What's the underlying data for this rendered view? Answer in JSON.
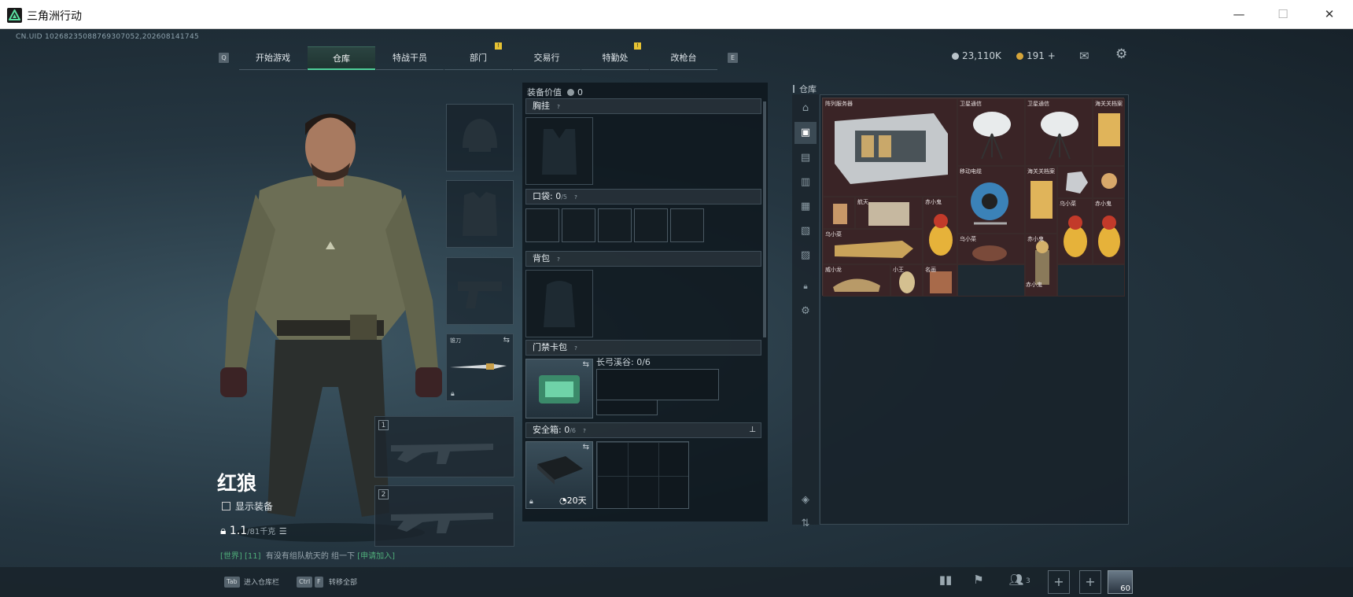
{
  "window": {
    "title": "三角洲行动",
    "minimize": "—",
    "maximize": "☐",
    "close": "✕"
  },
  "uid": "CN.UID 10268235088769307052,202608141745",
  "nav": {
    "left_key": "Q",
    "right_key": "E",
    "tabs": [
      {
        "label": "开始游戏",
        "active": false,
        "badge": ""
      },
      {
        "label": "仓库",
        "active": true,
        "badge": ""
      },
      {
        "label": "特战干员",
        "active": false,
        "badge": ""
      },
      {
        "label": "部门",
        "active": false,
        "badge": "!"
      },
      {
        "label": "交易行",
        "active": false,
        "badge": ""
      },
      {
        "label": "特勤处",
        "active": false,
        "badge": "!"
      },
      {
        "label": "改枪台",
        "active": false,
        "badge": ""
      }
    ]
  },
  "currency": {
    "hafcoin": "23,110K",
    "coupon": "191",
    "coupon_add": "+"
  },
  "character": {
    "name": "红狼",
    "show_equipment": "显示装备",
    "weight": "1.1",
    "weight_max": "/81千克",
    "chat_channel": "[世界] [11]",
    "chat_text": "有没有组队航天的 组一下",
    "chat_link": "[申请加入]"
  },
  "equipment": {
    "melee_label": "锥刀",
    "gun1_num": "1",
    "gun2_num": "2"
  },
  "loadout": {
    "value_label": "装备价值",
    "value": "0",
    "chest_label": "胸挂",
    "pocket_label": "口袋:",
    "pocket_used": "0",
    "pocket_max": "/5",
    "backpack_label": "背包",
    "keycard_label": "门禁卡包",
    "keycard_map": "长弓溪谷: 0/6",
    "safebox_label": "安全箱:",
    "safebox_used": "0",
    "safebox_max": "/6",
    "safebox_timer": "20天"
  },
  "stash": {
    "title": "仓库",
    "items": [
      {
        "name": "阵列服务器"
      },
      {
        "name": "卫星通信"
      },
      {
        "name": "卫星通信"
      },
      {
        "name": "海关关档案"
      },
      {
        "name": "移动电缆"
      },
      {
        "name": "海关关档案"
      },
      {
        "name": "航天"
      },
      {
        "name": "赤小鬼"
      },
      {
        "name": "乌小菜"
      },
      {
        "name": "赤小鬼"
      },
      {
        "name": "乌小菜"
      },
      {
        "name": "乌小菜"
      },
      {
        "name": "赤小鬼"
      },
      {
        "name": "威小龙"
      },
      {
        "name": "赤小鬼"
      },
      {
        "name": "小王"
      },
      {
        "name": "名画"
      }
    ]
  },
  "bottom": {
    "tab_key": "Tab",
    "tab_text": "进入仓库栏",
    "ctrl_key": "Ctrl",
    "f_key": "F",
    "f_text": "转移全部",
    "friends_count": "3",
    "level": "60"
  }
}
